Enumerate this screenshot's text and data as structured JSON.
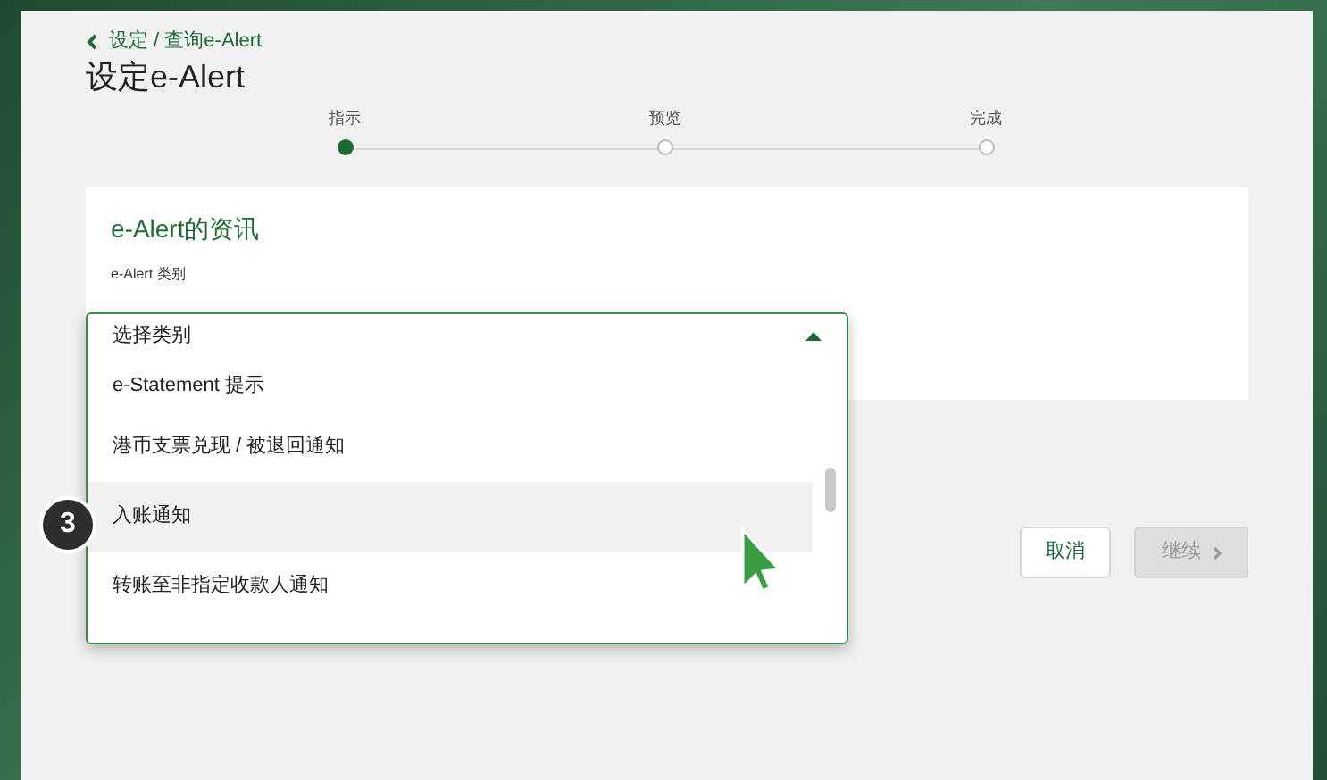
{
  "breadcrumb": {
    "label": "设定 / 查询e-Alert"
  },
  "title": "设定e-Alert",
  "steps": [
    {
      "label": "指示",
      "selected": true
    },
    {
      "label": "预览",
      "selected": false
    },
    {
      "label": "完成",
      "selected": false
    }
  ],
  "card": {
    "title": "e-Alert的资讯",
    "field_label": "e-Alert 类别"
  },
  "dropdown": {
    "prompt": "选择类别",
    "expanded": true,
    "options": [
      {
        "label": "e-Statement 提示",
        "highlighted": false
      },
      {
        "label": "港币支票兑现 / 被退回通知",
        "highlighted": false
      },
      {
        "label": "入账通知",
        "highlighted": true
      },
      {
        "label": "转账至非指定收款人通知",
        "highlighted": false
      }
    ]
  },
  "step_badge": "3",
  "buttons": [
    {
      "label": "取消",
      "kind": "secondary",
      "disabled": false
    },
    {
      "label": "继续",
      "kind": "primary",
      "disabled": true
    }
  ]
}
